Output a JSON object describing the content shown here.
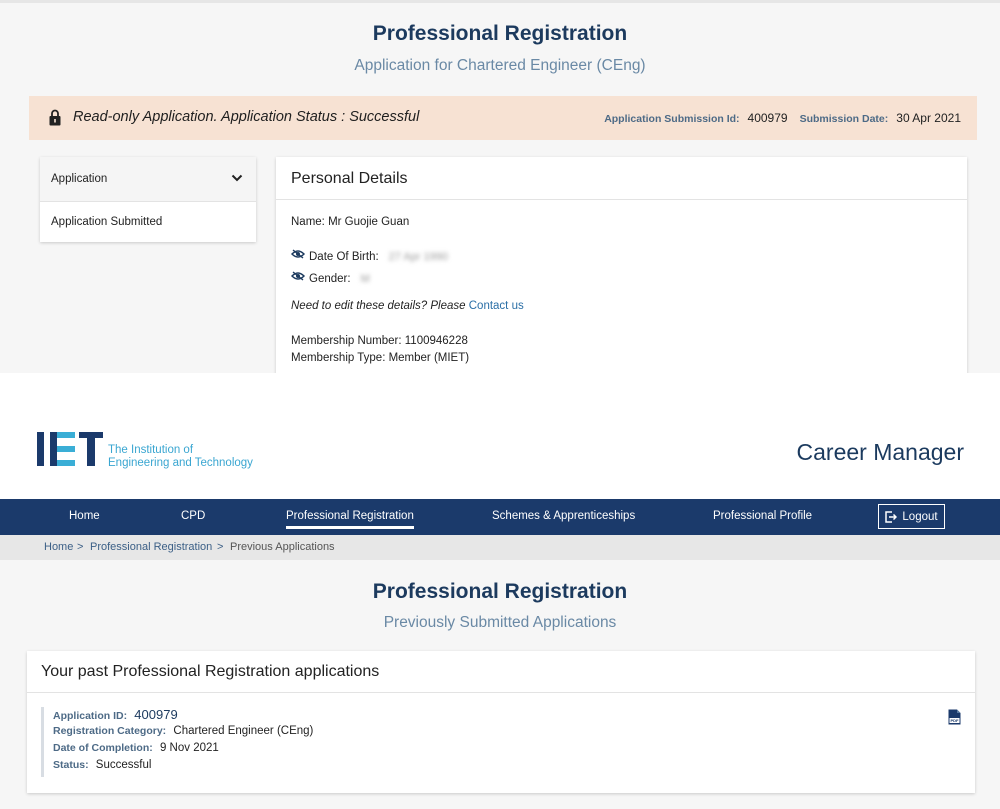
{
  "top": {
    "title": "Professional Registration",
    "subtitle": "Application for Chartered Engineer (CEng)",
    "banner": {
      "text": "Read-only Application. Application Status : Successful",
      "submission_id_label": "Application Submission Id:",
      "submission_id": "400979",
      "submission_date_label": "Submission Date:",
      "submission_date": "30 Apr 2021"
    },
    "sidebar": {
      "section": "Application",
      "items": [
        "Application Submitted"
      ]
    },
    "personal_details": {
      "title": "Personal Details",
      "name": "Name: Mr Guojie Guan",
      "dob_label": "Date Of Birth:",
      "dob_value": "27 Apr 1990",
      "gender_label": "Gender:",
      "gender_value": "M",
      "help_text": "Need to edit these details? Please",
      "contact_link": "Contact us",
      "membership_number": "Membership Number: 1100946228",
      "membership_type": "Membership Type: Member (MIET)"
    }
  },
  "bottom": {
    "logo_text_line1": "The Institution of",
    "logo_text_line2": "Engineering and Technology",
    "app_title": "Career Manager",
    "nav": {
      "items": [
        "Home",
        "CPD",
        "Professional Registration",
        "Schemes & Apprenticeships",
        "Professional Profile"
      ],
      "active": "Professional Registration",
      "logout": "Logout"
    },
    "breadcrumb": [
      "Home",
      "Professional Registration",
      "Previous Applications"
    ],
    "title": "Professional Registration",
    "subtitle": "Previously Submitted Applications",
    "card_title": "Your past Professional Registration applications",
    "application": {
      "id_label": "Application ID:",
      "id": "400979",
      "category_label": "Registration Category:",
      "category": "Chartered Engineer (CEng)",
      "completion_label": "Date of Completion:",
      "completion": "9 Nov 2021",
      "status_label": "Status:",
      "status": "Successful"
    }
  },
  "colors": {
    "navy": "#1b3a6b",
    "accent_blue": "#3aaed6",
    "banner_bg": "#f7e2d3",
    "subtitle": "#6a89a5"
  },
  "icons": [
    "lock-icon",
    "chevron-down-icon",
    "eye-slash-icon",
    "logout-icon",
    "pdf-icon"
  ]
}
